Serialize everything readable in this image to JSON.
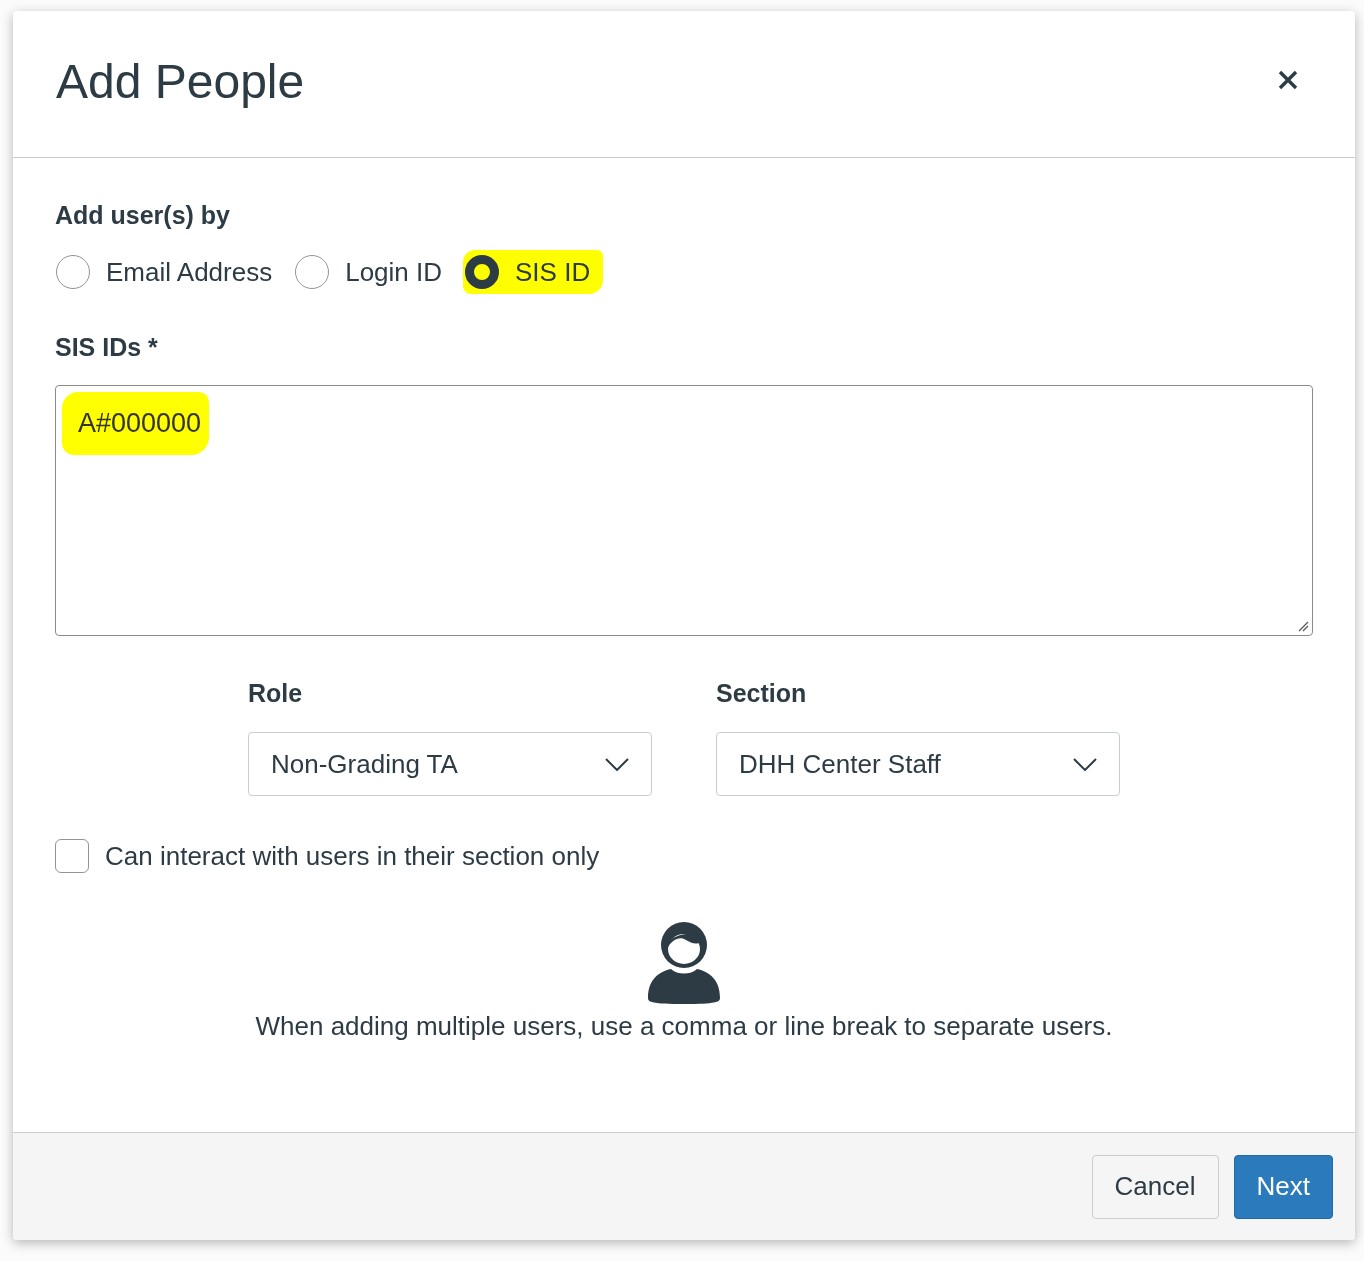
{
  "dialog": {
    "title": "Add People"
  },
  "add_by": {
    "label": "Add user(s) by",
    "options": [
      {
        "label": "Email Address",
        "selected": false,
        "highlighted": false
      },
      {
        "label": "Login ID",
        "selected": false,
        "highlighted": false
      },
      {
        "label": "SIS ID",
        "selected": true,
        "highlighted": true
      }
    ]
  },
  "ids_field": {
    "label": "SIS IDs *",
    "value": "A#000000",
    "highlighted": true
  },
  "role": {
    "label": "Role",
    "value": "Non-Grading TA"
  },
  "section": {
    "label": "Section",
    "value": "DHH Center Staff"
  },
  "section_only": {
    "label": "Can interact with users in their section only",
    "checked": false
  },
  "hint": "When adding multiple users, use a comma or line break to separate users.",
  "buttons": [
    {
      "label": "Cancel",
      "kind": "secondary"
    },
    {
      "label": "Next",
      "kind": "primary"
    }
  ]
}
